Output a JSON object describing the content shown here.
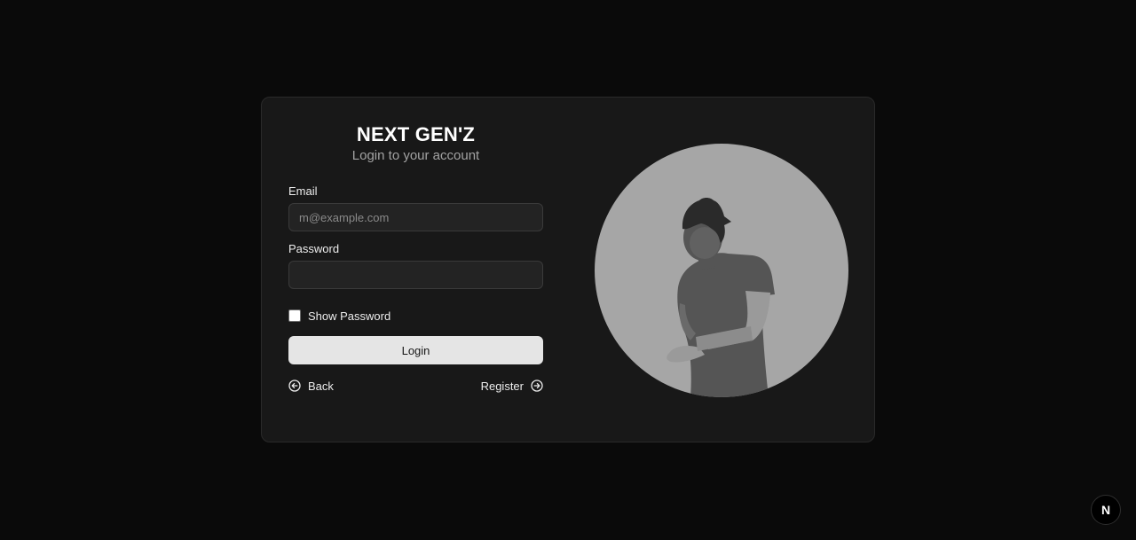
{
  "brand": {
    "title": "NEXT GEN'Z",
    "subtitle": "Login to your account"
  },
  "form": {
    "email": {
      "label": "Email",
      "placeholder": "m@example.com",
      "value": ""
    },
    "password": {
      "label": "Password",
      "placeholder": "",
      "value": ""
    },
    "show_password": {
      "label": "Show Password",
      "checked": false
    },
    "login_label": "Login"
  },
  "links": {
    "back_label": "Back",
    "back_icon": "arrow-left-circle-icon",
    "register_label": "Register",
    "register_icon": "arrow-right-circle-icon"
  },
  "illustration": {
    "icon": "person-silhouette-illustration",
    "circle_color": "#a6a6a6",
    "figure_color": "#555555"
  },
  "badge": {
    "label": "N",
    "icon": "nextjs-logo-icon"
  },
  "colors": {
    "background": "#0a0a0a",
    "card": "#181818",
    "button": "#e5e5e5",
    "muted_text": "#a3a3a3"
  }
}
